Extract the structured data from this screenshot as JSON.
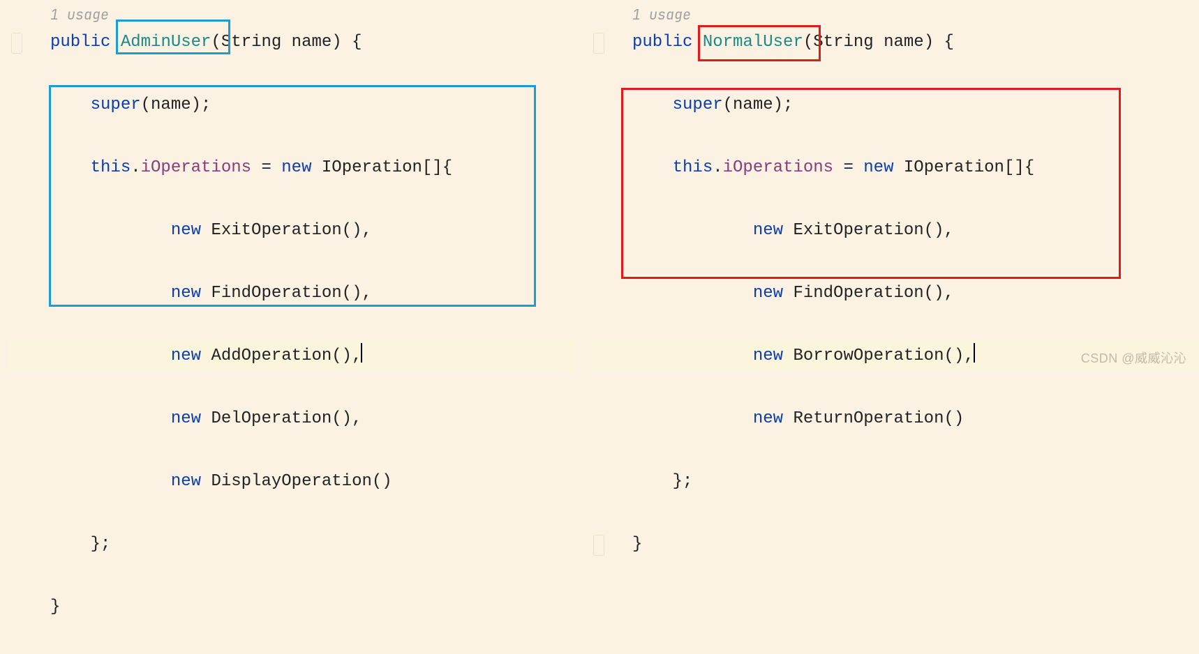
{
  "left": {
    "usage": "1 usage",
    "public": "public",
    "class_name": "AdminUser",
    "sig_open": "(",
    "param_type": "String",
    "param_name": " name",
    "sig_close": ") {",
    "super_kw": "super",
    "super_call": "(name);",
    "this_kw": "this",
    "dot": ".",
    "field": "iOperations",
    "assign": " = ",
    "new_kw": "new",
    "arr_type": " IOperation[]{",
    "ops": [
      {
        "new": "new",
        "name": " ExitOperation(),"
      },
      {
        "new": "new",
        "name": " FindOperation(),"
      },
      {
        "new": "new",
        "name": " AddOperation(),"
      },
      {
        "new": "new",
        "name": " DelOperation(),"
      },
      {
        "new": "new",
        "name": " DisplayOperation()"
      }
    ],
    "arr_close": "};",
    "brace_close": "}",
    "box_class": "#1c9cd6",
    "box_body": "#1c9cd6"
  },
  "right": {
    "usage": "1 usage",
    "public": "public",
    "class_name": "NormalUser",
    "sig_open": "(",
    "param_type": "String",
    "param_name": " name",
    "sig_close": ") {",
    "super_kw": "super",
    "super_call": "(name);",
    "this_kw": "this",
    "dot": ".",
    "field": "iOperations",
    "assign": " = ",
    "new_kw": "new",
    "arr_type": " IOperation[]{",
    "ops": [
      {
        "new": "new",
        "name": " ExitOperation(),"
      },
      {
        "new": "new",
        "name": " FindOperation(),"
      },
      {
        "new": "new",
        "name": " BorrowOperation(),"
      },
      {
        "new": "new",
        "name": " ReturnOperation()"
      }
    ],
    "arr_close": "};",
    "brace_close": "}",
    "box_class": "#e21a1a",
    "box_body": "#e21a1a"
  },
  "watermark": "CSDN @威威沁沁"
}
